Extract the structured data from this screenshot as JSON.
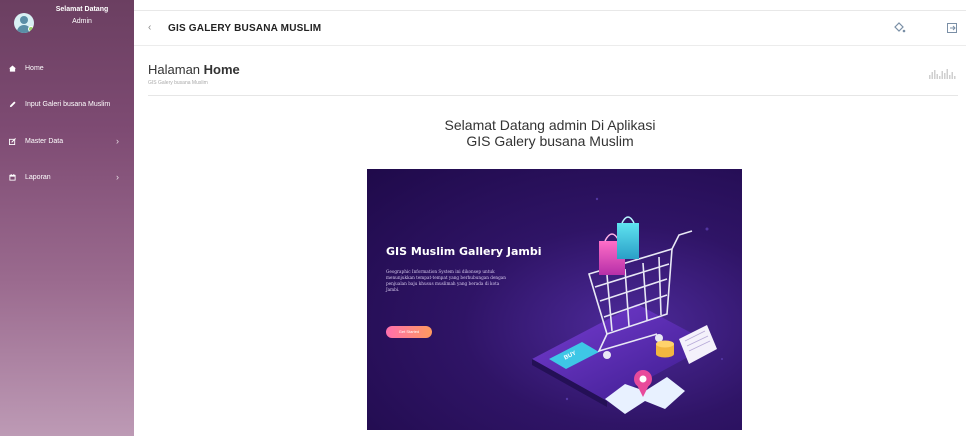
{
  "sidebar": {
    "profile": {
      "welcome": "Selamat Datang",
      "role": "Admin"
    },
    "items": [
      {
        "label": "Home",
        "icon": "home-icon",
        "has_submenu": false
      },
      {
        "label": "Input Galeri busana Muslim",
        "icon": "pencil-icon",
        "has_submenu": false
      },
      {
        "label": "Master Data",
        "icon": "edit-icon",
        "has_submenu": true
      },
      {
        "label": "Laporan",
        "icon": "calendar-icon",
        "has_submenu": true
      }
    ]
  },
  "topbar": {
    "back_glyph": "‹",
    "title": "GIS GALERY BUSANA MUSLIM",
    "icons": [
      "paint-bucket-icon",
      "logout-icon"
    ]
  },
  "page": {
    "title_prefix": "Halaman",
    "title_strong": "Home",
    "subtitle": "GIS Galery busana Muslim",
    "welcome_line1": "Selamat Datang admin Di Aplikasi",
    "welcome_line2": "GIS Galery busana Muslim"
  },
  "hero": {
    "title": "GIS Muslim Gallery Jambi",
    "description": "Geographic Information System ini dikonsep untuk menunjukkan tempat-tempat yang berhubungan dengan penjualan baju khusus muslimah yang berada di kota Jambi.",
    "button_label": "Get Started",
    "tag_label": "BUY"
  },
  "colors": {
    "sidebar_top": "#6b3f61",
    "sidebar_bottom": "#bd9ab5",
    "hero_background": "#2f1466",
    "accent_pink": "#ff6fae"
  }
}
